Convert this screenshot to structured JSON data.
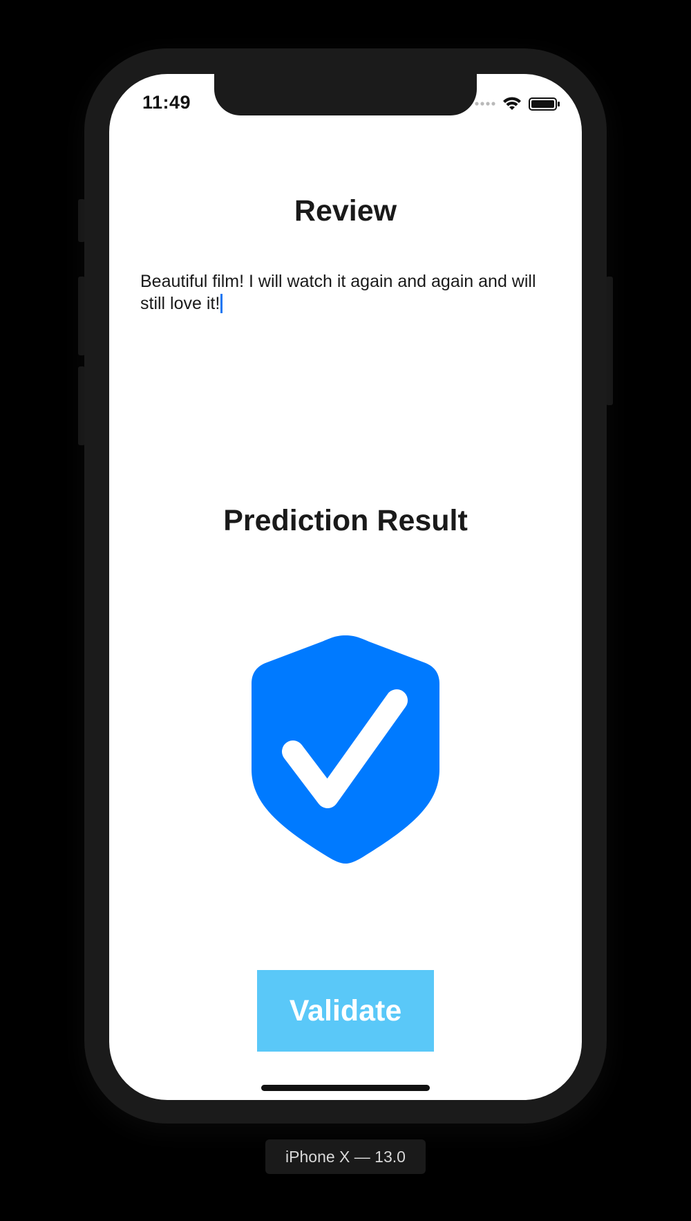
{
  "status_bar": {
    "time": "11:49",
    "icons": [
      "signal-dots-icon",
      "wifi-icon",
      "battery-icon"
    ]
  },
  "review": {
    "title": "Review",
    "text": "Beautiful film! I will watch it again and again and will still love it!"
  },
  "prediction": {
    "title": "Prediction Result",
    "icon": "shield-check-icon"
  },
  "actions": {
    "validate_label": "Validate"
  },
  "device": {
    "label": "iPhone X — 13.0"
  },
  "colors": {
    "accent": "#007AFF",
    "button": "#5AC8F8",
    "caret": "#1877F2",
    "frame": "#1B1B1B"
  }
}
